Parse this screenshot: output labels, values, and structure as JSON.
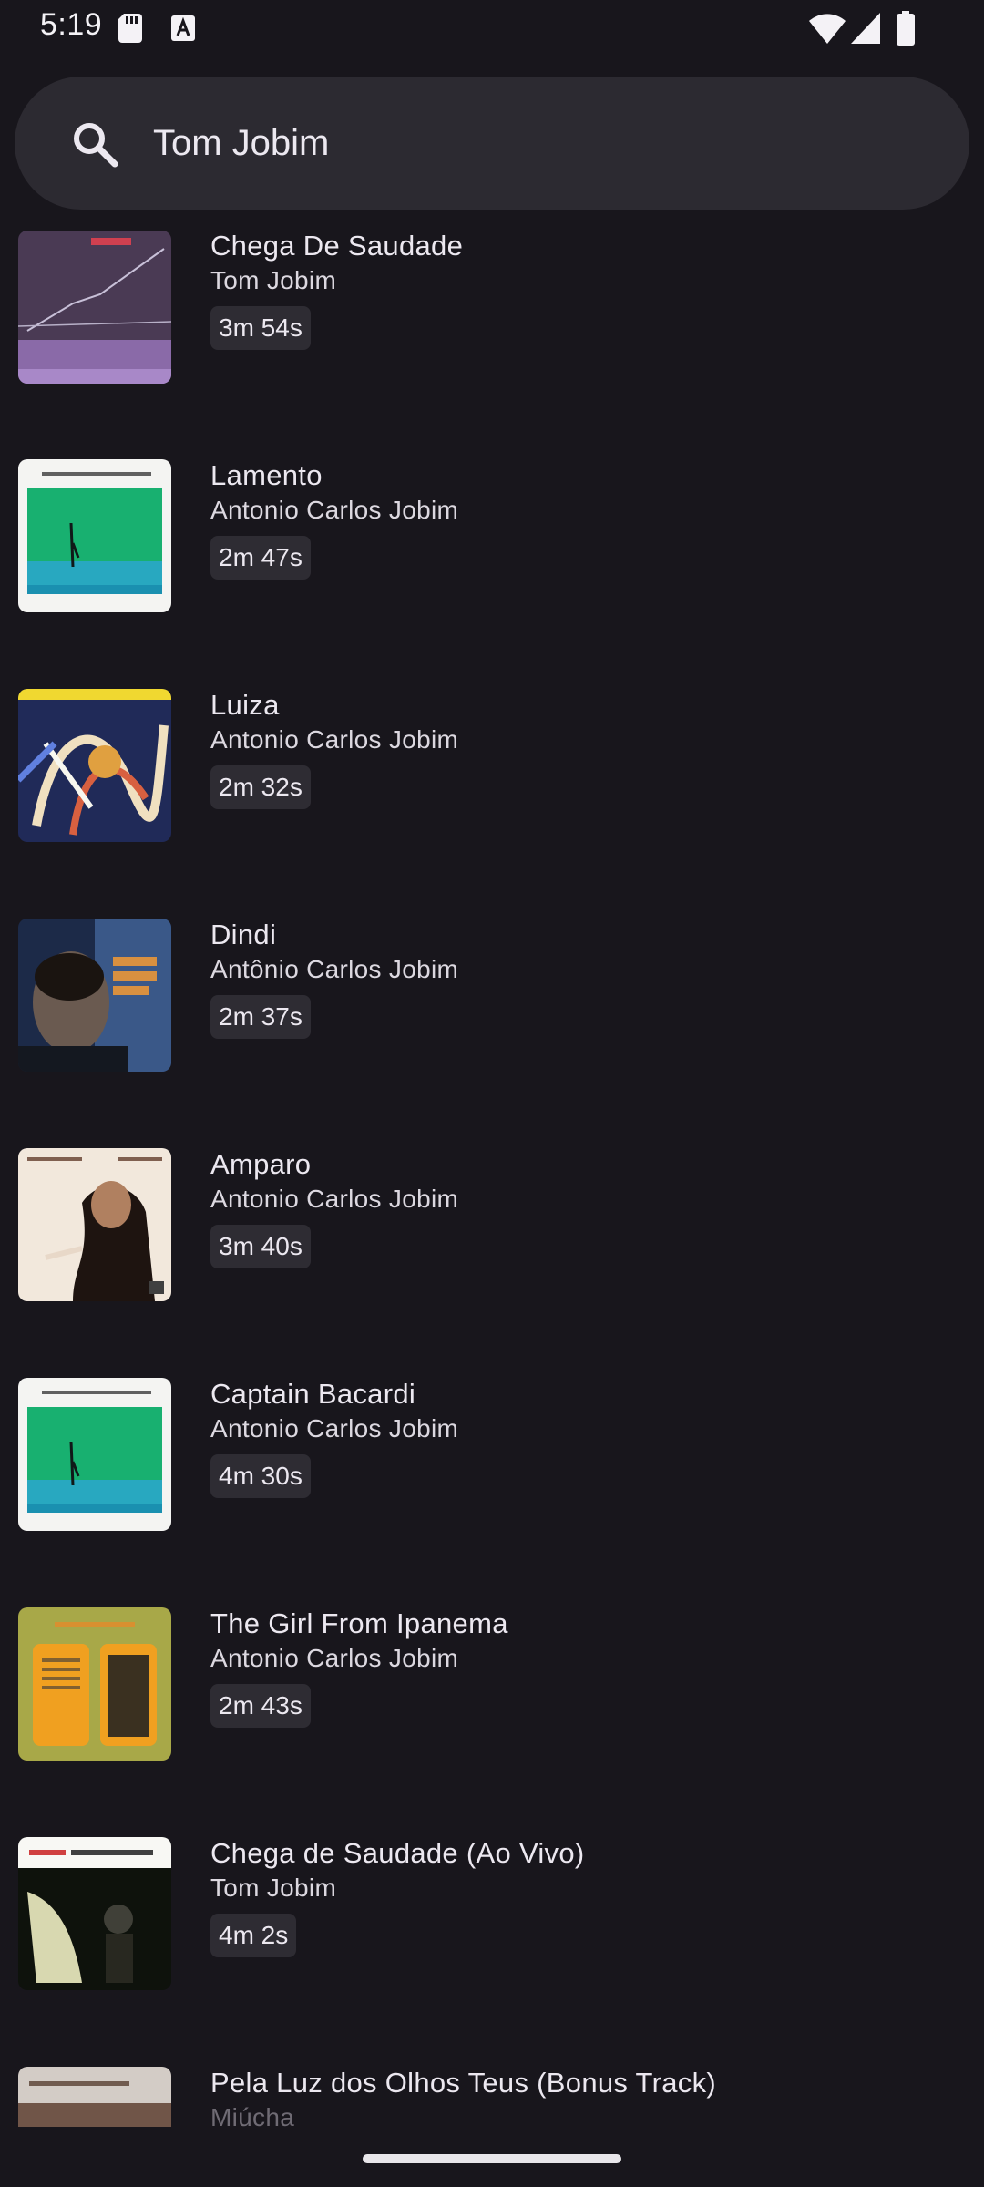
{
  "status_bar": {
    "time": "5:19",
    "icons": [
      "sd-card-icon",
      "a-icon",
      "wifi-icon",
      "signal-icon",
      "battery-icon"
    ]
  },
  "search": {
    "icon": "search-icon",
    "value": "Tom Jobim"
  },
  "results": [
    {
      "title": "Chega De Saudade",
      "artist": "Tom Jobim",
      "duration": "3m 54s"
    },
    {
      "title": "Lamento",
      "artist": "Antonio Carlos Jobim",
      "duration": "2m 47s"
    },
    {
      "title": "Luiza",
      "artist": "Antonio Carlos Jobim",
      "duration": "2m 32s"
    },
    {
      "title": "Dindi",
      "artist": "Antônio Carlos Jobim",
      "duration": "2m 37s"
    },
    {
      "title": "Amparo",
      "artist": "Antonio Carlos Jobim",
      "duration": "3m 40s"
    },
    {
      "title": "Captain Bacardi",
      "artist": "Antonio Carlos Jobim",
      "duration": "4m 30s"
    },
    {
      "title": "The Girl From Ipanema",
      "artist": "Antonio Carlos Jobim",
      "duration": "2m 43s"
    },
    {
      "title": "Chega de Saudade (Ao Vivo)",
      "artist": "Tom Jobim",
      "duration": "4m 2s"
    },
    {
      "title": "Pela Luz dos Olhos Teus (Bonus Track)",
      "artist": "Miúcha",
      "duration": ""
    }
  ],
  "colors": {
    "background": "#18161c",
    "search_bar": "#2c2a31",
    "chip": "#2e2c33",
    "text": "#ece8f0"
  }
}
